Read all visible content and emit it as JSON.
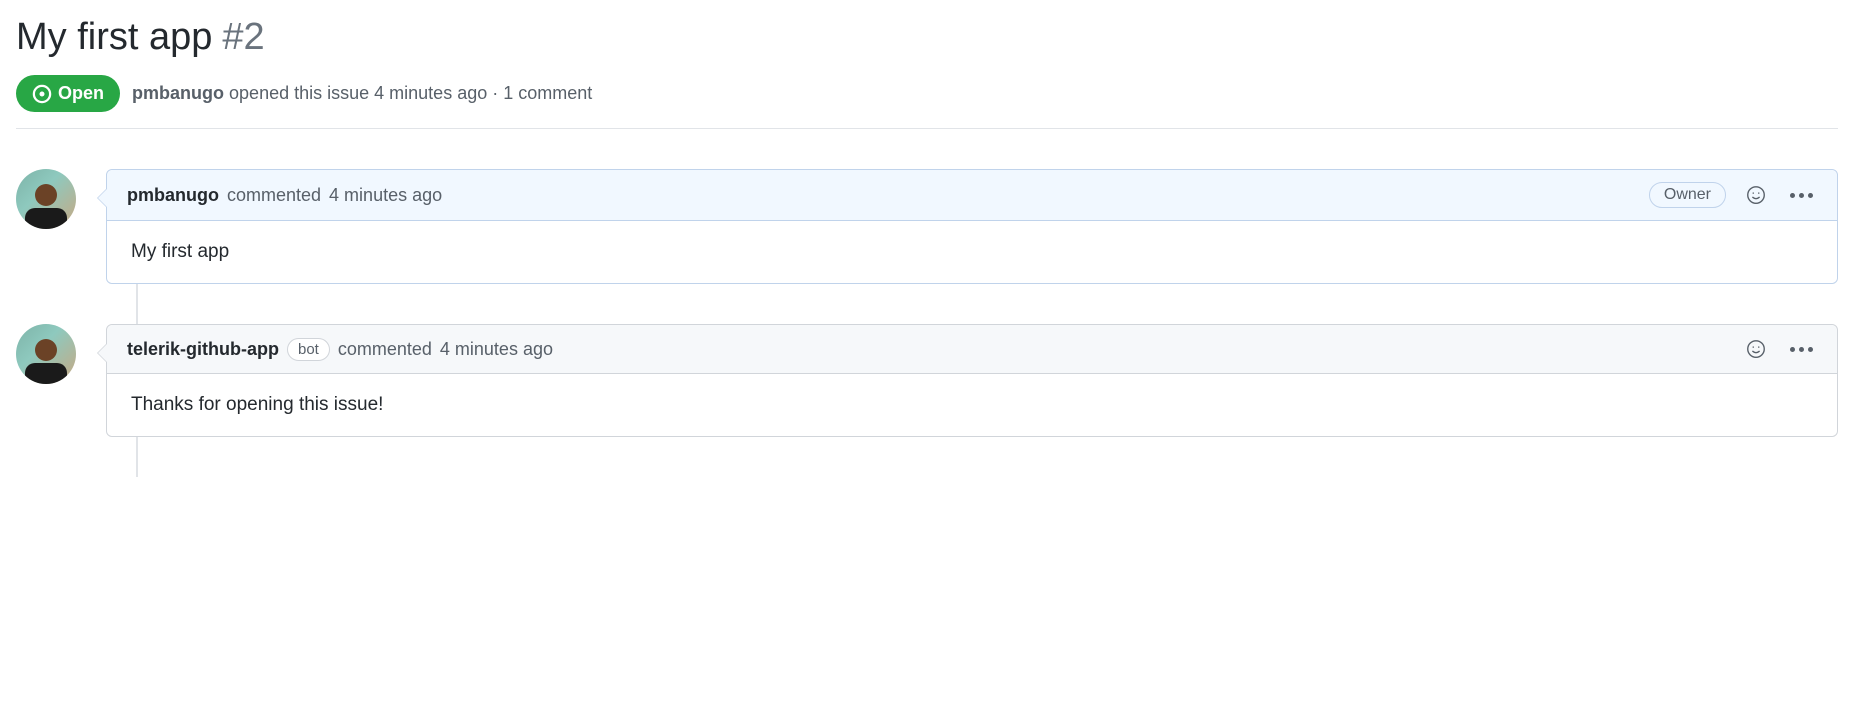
{
  "issue": {
    "title": "My first app",
    "number": "#2",
    "status": "Open",
    "meta_author": "pmbanugo",
    "meta_action": "opened this issue",
    "meta_time": "4 minutes ago",
    "meta_separator": "·",
    "meta_comments": "1 comment"
  },
  "comments": [
    {
      "author": "pmbanugo",
      "commented_text": "commented",
      "time": "4 minutes ago",
      "badge": "Owner",
      "is_owner": true,
      "body": "My first app"
    },
    {
      "author": "telerik-github-app",
      "bot_label": "bot",
      "commented_text": "commented",
      "time": "4 minutes ago",
      "is_owner": false,
      "body": "Thanks for opening this issue!"
    }
  ]
}
